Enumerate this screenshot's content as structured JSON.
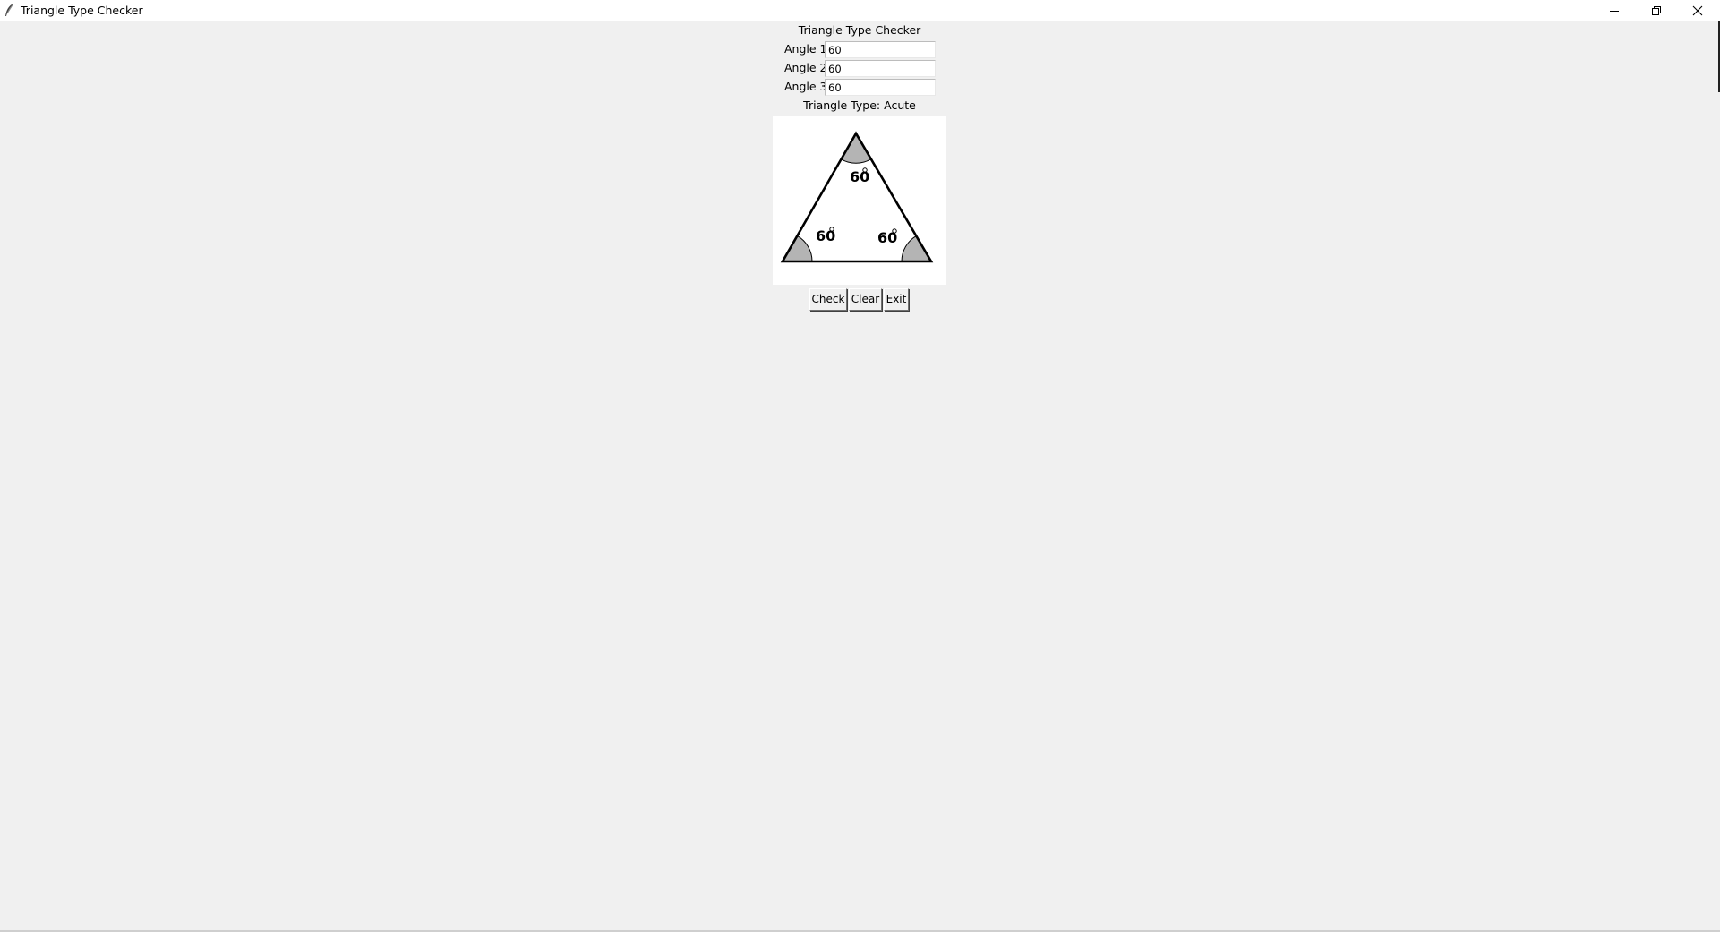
{
  "window": {
    "title": "Triangle Type Checker"
  },
  "app": {
    "header": "Triangle Type Checker",
    "angles": [
      {
        "label": "Angle 1:",
        "value": "60"
      },
      {
        "label": "Angle 2:",
        "value": "60"
      },
      {
        "label": "Angle 3:",
        "value": "60"
      }
    ],
    "result": "Triangle Type: Acute",
    "diagram": {
      "top_angle": "60",
      "left_angle": "60",
      "right_angle": "60"
    },
    "buttons": {
      "check": "Check",
      "clear": "Clear",
      "exit": "Exit"
    }
  },
  "colors": {
    "window_bg": "#f0f0f0",
    "titlebar_bg": "#ffffff",
    "canvas_bg": "#ffffff",
    "angle_fill": "#b4b4b4"
  },
  "icons": {
    "app": "feather-icon",
    "minimize": "minimize-icon",
    "maximize": "restore-icon",
    "close": "close-icon"
  }
}
